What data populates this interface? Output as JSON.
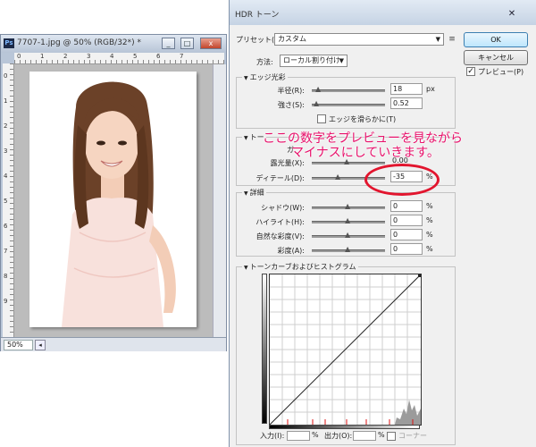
{
  "document": {
    "title": "7707-1.jpg @ 50% (RGB/32*) *",
    "ps_icon": "Ps",
    "window_buttons": [
      "_",
      "□",
      "x"
    ],
    "ruler_top_numbers": [
      "0",
      "1",
      "2",
      "3",
      "4",
      "5",
      "6",
      "7"
    ],
    "ruler_left_numbers": [
      "0",
      "1",
      "2",
      "3",
      "4",
      "5",
      "6",
      "7",
      "8",
      "9"
    ],
    "zoom": "50%"
  },
  "dialog": {
    "title": "HDR トーン",
    "close_glyph": "✕",
    "preset_label": "プリセット(E):",
    "preset_value": "カスタム",
    "method_label": "方法:",
    "method_value": "ローカル割り付け",
    "buttons": {
      "ok": "OK",
      "cancel": "キャンセル",
      "preview_label": "プレビュー(P)",
      "preview_checked": true
    },
    "edge_glow": {
      "heading": "エッジ光彩",
      "radius": {
        "label": "半径(R):",
        "value": "18",
        "unit": "px"
      },
      "strength": {
        "label": "強さ(S):",
        "value": "0.52",
        "unit": ""
      },
      "smooth_edges_label": "エッジを滑らかに(T)",
      "smooth_edges_checked": false
    },
    "tone_detail": {
      "heading_fragment": "トー",
      "gamma_fragment": "ガ",
      "exposure": {
        "label": "露光量(X):",
        "value": "0.00",
        "unit": ""
      },
      "detail": {
        "label": "ディテール(D):",
        "value": "-35",
        "unit": "%"
      }
    },
    "advanced": {
      "heading": "詳細",
      "rows": [
        {
          "label": "シャドウ(W):",
          "value": "0",
          "unit": "%"
        },
        {
          "label": "ハイライト(H):",
          "value": "0",
          "unit": "%"
        },
        {
          "label": "自然な彩度(V):",
          "value": "0",
          "unit": "%"
        },
        {
          "label": "彩度(A):",
          "value": "0",
          "unit": "%"
        }
      ]
    },
    "curve": {
      "heading": "トーンカーブおよびヒストグラム",
      "input_label": "入力(I):",
      "output_label": "出力(O):",
      "percent": "%",
      "corner_label": "コーナー"
    }
  },
  "annotation": {
    "line1": "ここの数字をプレビューを見ながら",
    "line2": "マイナスにしていきます。",
    "color": "#e8116b",
    "ellipse_color": "#e2152e"
  }
}
